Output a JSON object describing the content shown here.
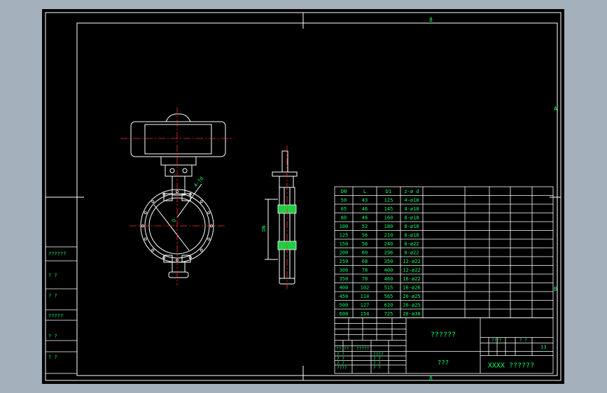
{
  "colors": {
    "background": "#000000",
    "frame": "#ffffff",
    "table_line": "#ffffff",
    "text": "#00ff66",
    "center_line": "#ff2b2b",
    "part": "#ffffff",
    "accent": "#22cc44"
  },
  "frame": {
    "zone_marks_top": [
      "8"
    ],
    "zone_marks_bottom": [
      "8"
    ],
    "zone_marks_right": [
      "A",
      "B"
    ]
  },
  "left_strip": {
    "labels": [
      "??????",
      "? ?",
      "? ?",
      "?????",
      "? ?",
      "? ?"
    ]
  },
  "views": {
    "dimension_label_side": "DN",
    "dimension_label_front": "D",
    "dimension_label_stem": "4-?d"
  },
  "size_table": {
    "headers": [
      "DN",
      "L",
      "D1",
      "z-ø d"
    ],
    "rows": [
      [
        "50",
        "43",
        "125",
        "4-ø18"
      ],
      [
        "65",
        "46",
        "145",
        "4-ø18"
      ],
      [
        "80",
        "46",
        "160",
        "8-ø18"
      ],
      [
        "100",
        "52",
        "180",
        "8-ø18"
      ],
      [
        "125",
        "56",
        "210",
        "8-ø18"
      ],
      [
        "150",
        "56",
        "240",
        "8-ø22"
      ],
      [
        "200",
        "60",
        "296",
        "8-ø22"
      ],
      [
        "250",
        "68",
        "350",
        "12-ø22"
      ],
      [
        "300",
        "78",
        "400",
        "12-ø22"
      ],
      [
        "350",
        "78",
        "460",
        "16-ø22"
      ],
      [
        "400",
        "102",
        "515",
        "16-ø26"
      ],
      [
        "450",
        "114",
        "565",
        "20-ø25"
      ],
      [
        "500",
        "127",
        "620",
        "20-ø25"
      ],
      [
        "600",
        "154",
        "725",
        "20-ø30"
      ]
    ]
  },
  "title_block": {
    "drawing_name": "??????",
    "material": "???",
    "company": "XXXX ??????",
    "scale_label": "????",
    "sheet_label": "? ?",
    "scale_value": "13",
    "small_row_1": "?? ??",
    "small_row_2": "?????",
    "left_rows": [
      "? ?",
      "? ?",
      "? ?",
      "????"
    ],
    "mid_rows": [
      "????",
      "? ?",
      "? ?",
      "? ?"
    ]
  }
}
